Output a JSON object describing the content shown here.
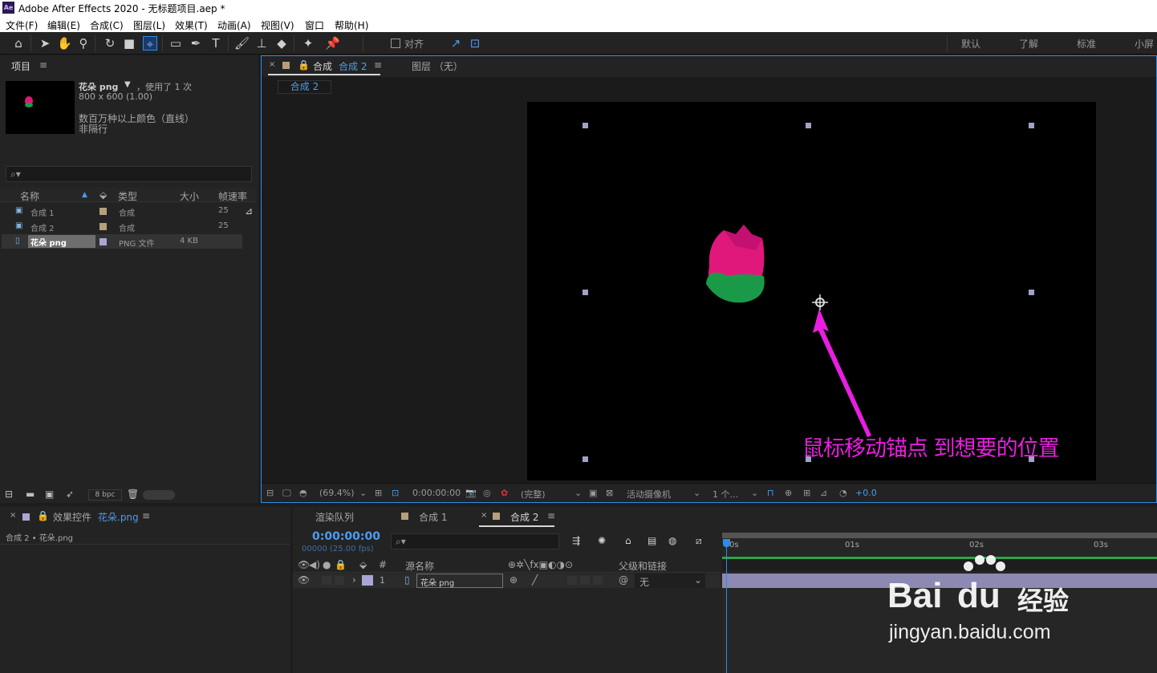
{
  "window": {
    "title": "Adobe After Effects 2020 - 无标题项目.aep *",
    "logo": "Ae"
  },
  "menu": [
    "文件(F)",
    "编辑(E)",
    "合成(C)",
    "图层(L)",
    "效果(T)",
    "动画(A)",
    "视图(V)",
    "窗口",
    "帮助(H)"
  ],
  "toolbar": {
    "align_label": "对齐",
    "workspaces": [
      "默认",
      "了解",
      "标准",
      "小屏"
    ]
  },
  "project": {
    "tab": "项目",
    "preview": {
      "name": "花朵 png",
      "used": "，使用了 1 次",
      "dims": "800 x 600 (1.00)",
      "color": "数百万种以上颜色（直线）",
      "alpha": "非隔行"
    },
    "search_placeholder": "",
    "columns": [
      "名称",
      "类型",
      "大小",
      "帧速率"
    ],
    "items": [
      {
        "name": "合成 1",
        "type": "合成",
        "size": "",
        "fps": "25",
        "label": "#b5a07a"
      },
      {
        "name": "合成 2",
        "type": "合成",
        "size": "",
        "fps": "25",
        "label": "#b5a07a"
      },
      {
        "name": "花朵 png",
        "type": "PNG 文件",
        "size": "4 KB",
        "fps": "",
        "label": "#a9a6d6"
      }
    ],
    "bpc": "8 bpc"
  },
  "viewer": {
    "tab_prefix": "合成",
    "tab_name": "合成 2",
    "layer_tab": "图层 （无）",
    "breadcrumb": "合成 2",
    "annotation": "鼠标移动锚点 到想要的位置",
    "zoom": "(69.4%)",
    "timecode": "0:00:00:00",
    "resolution": "(完整)",
    "camera": "活动摄像机",
    "views": "1 个...",
    "exposure": "+0.0"
  },
  "effects": {
    "tab_prefix": "效果控件",
    "tab_name": "花朵.png",
    "breadcrumb": "合成 2 • 花朵.png"
  },
  "timeline": {
    "tabs": [
      "渲染队列",
      "合成 1",
      "合成 2"
    ],
    "timecode": "0:00:00:00",
    "fps_line": "00000 (25.00 fps)",
    "col_source": "源名称",
    "col_parent": "父级和链接",
    "hash": "#",
    "layer": {
      "index": "1",
      "name": "花朵 png",
      "parent": "无"
    },
    "ruler": [
      "0s",
      "01s",
      "02s",
      "03s"
    ]
  },
  "watermark": {
    "brand": "Bai",
    "brand2": "du",
    "cn": "经验",
    "url": "jingyan.baidu.com"
  },
  "colors": {
    "accent": "#2d8ceb",
    "annotation": "#e91ee0",
    "label_comp": "#b5a07a",
    "label_png": "#a9a6d6"
  }
}
